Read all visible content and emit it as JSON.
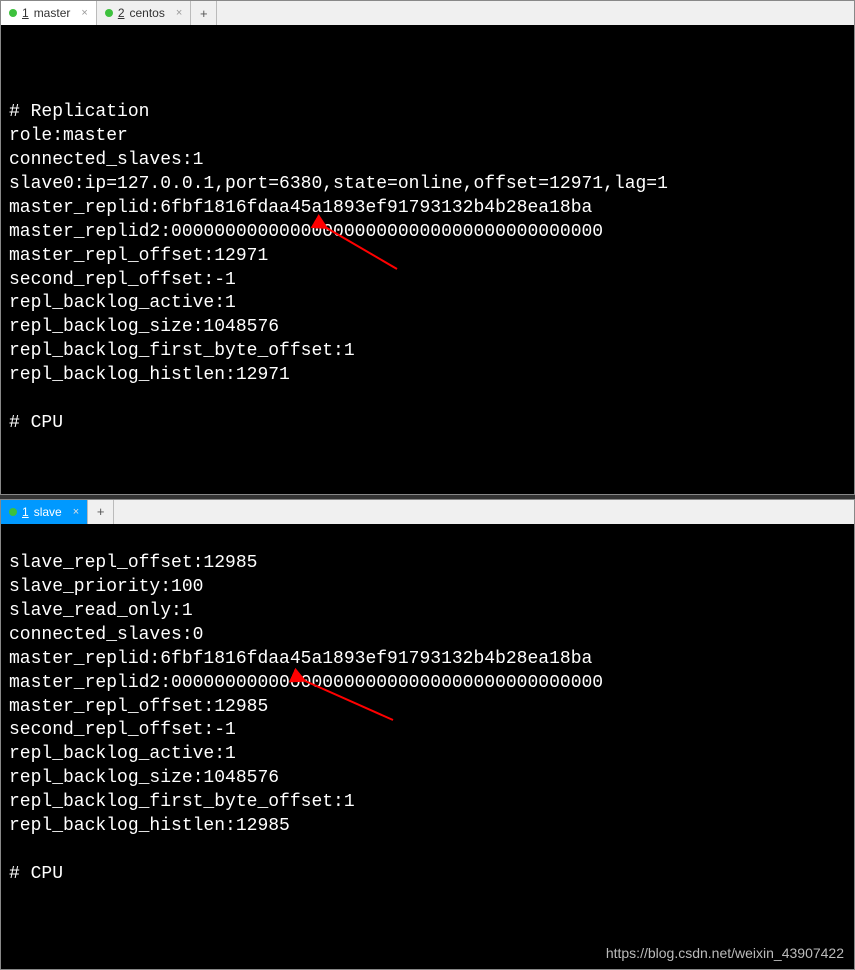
{
  "top": {
    "tabs": [
      {
        "num": "1",
        "label": "master"
      },
      {
        "num": "2",
        "label": "centos"
      }
    ],
    "lines": [
      "",
      "# Replication",
      "role:master",
      "connected_slaves:1",
      "slave0:ip=127.0.0.1,port=6380,state=online,offset=12971,lag=1",
      "master_replid:6fbf1816fdaa45a1893ef91793132b4b28ea18ba",
      "master_replid2:0000000000000000000000000000000000000000",
      "master_repl_offset:12971",
      "second_repl_offset:-1",
      "repl_backlog_active:1",
      "repl_backlog_size:1048576",
      "repl_backlog_first_byte_offset:1",
      "repl_backlog_histlen:12971",
      "",
      "# CPU"
    ]
  },
  "bottom": {
    "tabs": [
      {
        "num": "1",
        "label": "slave"
      }
    ],
    "lines": [
      "slave_repl_offset:12985",
      "slave_priority:100",
      "slave_read_only:1",
      "connected_slaves:0",
      "master_replid:6fbf1816fdaa45a1893ef91793132b4b28ea18ba",
      "master_replid2:0000000000000000000000000000000000000000",
      "master_repl_offset:12985",
      "second_repl_offset:-1",
      "repl_backlog_active:1",
      "repl_backlog_size:1048576",
      "repl_backlog_first_byte_offset:1",
      "repl_backlog_histlen:12985",
      "",
      "# CPU"
    ]
  },
  "watermark": "https://blog.csdn.net/weixin_43907422",
  "ui": {
    "add_tab": "+",
    "close_x": "×"
  }
}
